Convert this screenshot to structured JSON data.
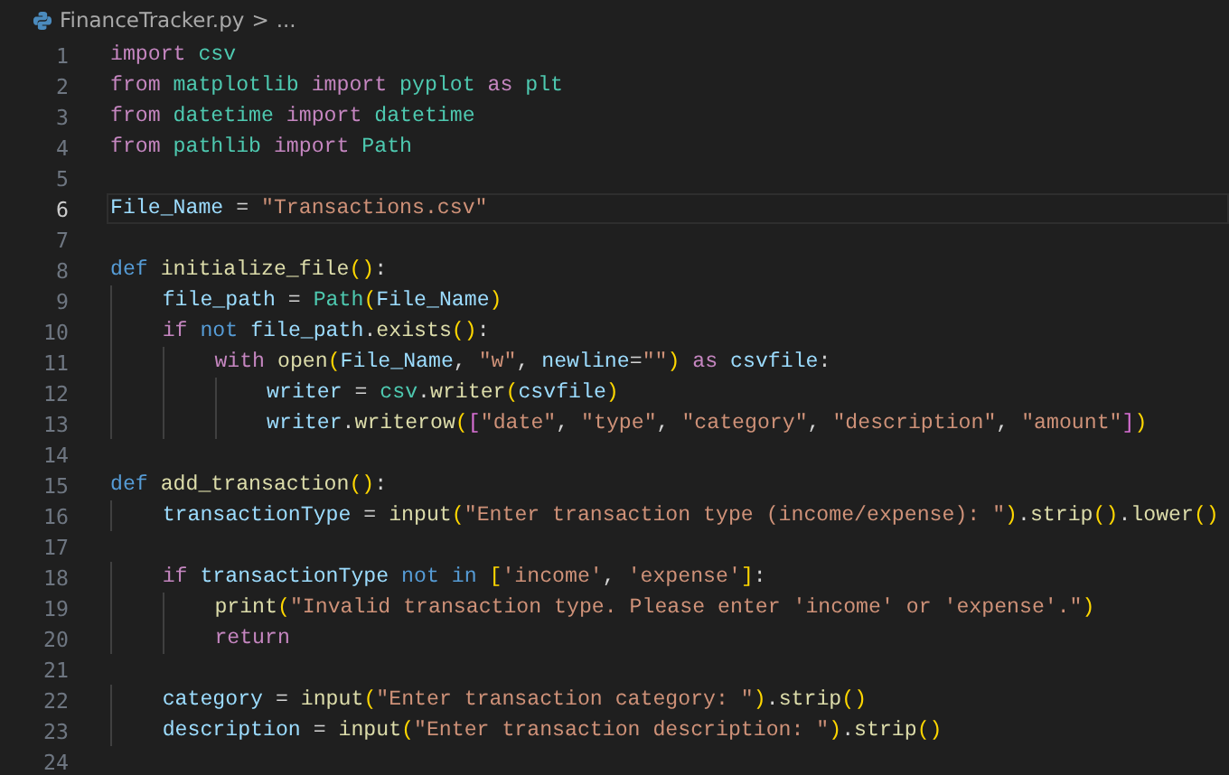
{
  "breadcrumb": {
    "file": "FinanceTracker.py",
    "separator": ">",
    "rest": "..."
  },
  "lines": [
    {
      "number": "1",
      "selected": false,
      "tokens": [
        {
          "kind": "kw",
          "text": "import"
        },
        {
          "kind": "mod",
          "text": " csv"
        }
      ]
    },
    {
      "number": "2",
      "selected": false,
      "tokens": [
        {
          "kind": "kw",
          "text": "from"
        },
        {
          "kind": "mod",
          "text": " matplotlib"
        },
        {
          "kind": "kw",
          "text": " import"
        },
        {
          "kind": "mod",
          "text": " pyplot"
        },
        {
          "kind": "kw",
          "text": " as"
        },
        {
          "kind": "mod",
          "text": " plt"
        }
      ]
    },
    {
      "number": "3",
      "selected": false,
      "tokens": [
        {
          "kind": "kw",
          "text": "from"
        },
        {
          "kind": "mod",
          "text": " datetime"
        },
        {
          "kind": "kw",
          "text": " import"
        },
        {
          "kind": "mod",
          "text": " datetime"
        }
      ]
    },
    {
      "number": "4",
      "selected": false,
      "tokens": [
        {
          "kind": "kw",
          "text": "from"
        },
        {
          "kind": "mod",
          "text": " pathlib"
        },
        {
          "kind": "kw",
          "text": " import"
        },
        {
          "kind": "mod",
          "text": " Path"
        }
      ]
    },
    {
      "number": "5",
      "selected": false
    },
    {
      "number": "6",
      "selected": true,
      "tokens": [
        {
          "kind": "var",
          "text": "File_Name"
        },
        {
          "kind": "plain",
          "text": " = "
        },
        {
          "kind": "str",
          "text": "\"Transactions.csv\""
        }
      ]
    },
    {
      "number": "7",
      "selected": false
    },
    {
      "number": "8",
      "selected": false,
      "tokens": [
        {
          "kind": "kw2",
          "text": "def"
        },
        {
          "kind": "fn",
          "text": " initialize_file"
        },
        {
          "kind": "p1",
          "text": "()"
        },
        {
          "kind": "plain",
          "text": ":"
        }
      ]
    },
    {
      "number": "9",
      "selected": false,
      "tokens": [
        {
          "kind": "var",
          "text": "    file_path"
        },
        {
          "kind": "plain",
          "text": " = "
        },
        {
          "kind": "mod",
          "text": "Path"
        },
        {
          "kind": "p1",
          "text": "("
        },
        {
          "kind": "var",
          "text": "File_Name"
        },
        {
          "kind": "p1",
          "text": ")"
        }
      ]
    },
    {
      "number": "10",
      "selected": false,
      "tokens": [
        {
          "kind": "kw",
          "text": "    if"
        },
        {
          "kind": "kw2",
          "text": " not"
        },
        {
          "kind": "var",
          "text": " file_path"
        },
        {
          "kind": "plain",
          "text": "."
        },
        {
          "kind": "fn",
          "text": "exists"
        },
        {
          "kind": "p1",
          "text": "()"
        },
        {
          "kind": "plain",
          "text": ":"
        }
      ]
    },
    {
      "number": "11",
      "selected": false,
      "tokens": [
        {
          "kind": "kw",
          "text": "        with"
        },
        {
          "kind": "fn",
          "text": " open"
        },
        {
          "kind": "p1",
          "text": "("
        },
        {
          "kind": "var",
          "text": "File_Name"
        },
        {
          "kind": "plain",
          "text": ", "
        },
        {
          "kind": "str",
          "text": "\"w\""
        },
        {
          "kind": "plain",
          "text": ", "
        },
        {
          "kind": "var",
          "text": "newline"
        },
        {
          "kind": "plain",
          "text": "="
        },
        {
          "kind": "str",
          "text": "\"\""
        },
        {
          "kind": "p1",
          "text": ")"
        },
        {
          "kind": "kw",
          "text": " as"
        },
        {
          "kind": "var",
          "text": " csvfile"
        },
        {
          "kind": "plain",
          "text": ":"
        }
      ]
    },
    {
      "number": "12",
      "selected": false,
      "tokens": [
        {
          "kind": "var",
          "text": "            writer"
        },
        {
          "kind": "plain",
          "text": " = "
        },
        {
          "kind": "mod",
          "text": "csv"
        },
        {
          "kind": "plain",
          "text": "."
        },
        {
          "kind": "fn",
          "text": "writer"
        },
        {
          "kind": "p1",
          "text": "("
        },
        {
          "kind": "var",
          "text": "csvfile"
        },
        {
          "kind": "p1",
          "text": ")"
        }
      ]
    },
    {
      "number": "13",
      "selected": false,
      "tokens": [
        {
          "kind": "var",
          "text": "            writer"
        },
        {
          "kind": "plain",
          "text": "."
        },
        {
          "kind": "fn",
          "text": "writerow"
        },
        {
          "kind": "p1",
          "text": "("
        },
        {
          "kind": "p2",
          "text": "["
        },
        {
          "kind": "str",
          "text": "\"date\""
        },
        {
          "kind": "plain",
          "text": ", "
        },
        {
          "kind": "str",
          "text": "\"type\""
        },
        {
          "kind": "plain",
          "text": ", "
        },
        {
          "kind": "str",
          "text": "\"category\""
        },
        {
          "kind": "plain",
          "text": ", "
        },
        {
          "kind": "str",
          "text": "\"description\""
        },
        {
          "kind": "plain",
          "text": ", "
        },
        {
          "kind": "str",
          "text": "\"amount\""
        },
        {
          "kind": "p2",
          "text": "]"
        },
        {
          "kind": "p1",
          "text": ")"
        }
      ]
    },
    {
      "number": "14",
      "selected": false
    },
    {
      "number": "15",
      "selected": false,
      "tokens": [
        {
          "kind": "kw2",
          "text": "def"
        },
        {
          "kind": "fn",
          "text": " add_transaction"
        },
        {
          "kind": "p1",
          "text": "()"
        },
        {
          "kind": "plain",
          "text": ":"
        }
      ]
    },
    {
      "number": "16",
      "selected": false,
      "tokens": [
        {
          "kind": "var",
          "text": "    transactionType"
        },
        {
          "kind": "plain",
          "text": " = "
        },
        {
          "kind": "fn",
          "text": "input"
        },
        {
          "kind": "p1",
          "text": "("
        },
        {
          "kind": "str",
          "text": "\"Enter transaction type (income/expense): \""
        },
        {
          "kind": "p1",
          "text": ")"
        },
        {
          "kind": "plain",
          "text": "."
        },
        {
          "kind": "fn",
          "text": "strip"
        },
        {
          "kind": "p1",
          "text": "()"
        },
        {
          "kind": "plain",
          "text": "."
        },
        {
          "kind": "fn",
          "text": "lower"
        },
        {
          "kind": "p1",
          "text": "()"
        }
      ]
    },
    {
      "number": "17",
      "selected": false
    },
    {
      "number": "18",
      "selected": false,
      "tokens": [
        {
          "kind": "kw",
          "text": "    if"
        },
        {
          "kind": "var",
          "text": " transactionType"
        },
        {
          "kind": "kw2",
          "text": " not in"
        },
        {
          "kind": "p1",
          "text": " ["
        },
        {
          "kind": "str",
          "text": "'income'"
        },
        {
          "kind": "plain",
          "text": ", "
        },
        {
          "kind": "str",
          "text": "'expense'"
        },
        {
          "kind": "p1",
          "text": "]"
        },
        {
          "kind": "plain",
          "text": ":"
        }
      ]
    },
    {
      "number": "19",
      "selected": false,
      "tokens": [
        {
          "kind": "fn",
          "text": "        print"
        },
        {
          "kind": "p1",
          "text": "("
        },
        {
          "kind": "str",
          "text": "\"Invalid transaction type. Please enter 'income' or 'expense'.\""
        },
        {
          "kind": "p1",
          "text": ")"
        }
      ]
    },
    {
      "number": "20",
      "selected": false,
      "tokens": [
        {
          "kind": "kw",
          "text": "        return"
        }
      ]
    },
    {
      "number": "21",
      "selected": false
    },
    {
      "number": "22",
      "selected": false,
      "tokens": [
        {
          "kind": "var",
          "text": "    category"
        },
        {
          "kind": "plain",
          "text": " = "
        },
        {
          "kind": "fn",
          "text": "input"
        },
        {
          "kind": "p1",
          "text": "("
        },
        {
          "kind": "str",
          "text": "\"Enter transaction category: \""
        },
        {
          "kind": "p1",
          "text": ")"
        },
        {
          "kind": "plain",
          "text": "."
        },
        {
          "kind": "fn",
          "text": "strip"
        },
        {
          "kind": "p1",
          "text": "()"
        }
      ]
    },
    {
      "number": "23",
      "selected": false,
      "tokens": [
        {
          "kind": "var",
          "text": "    description"
        },
        {
          "kind": "plain",
          "text": " = "
        },
        {
          "kind": "fn",
          "text": "input"
        },
        {
          "kind": "p1",
          "text": "("
        },
        {
          "kind": "str",
          "text": "\"Enter transaction description: \""
        },
        {
          "kind": "p1",
          "text": ")"
        },
        {
          "kind": "plain",
          "text": "."
        },
        {
          "kind": "fn",
          "text": "strip"
        },
        {
          "kind": "p1",
          "text": "()"
        }
      ]
    },
    {
      "number": "24",
      "selected": false
    }
  ]
}
